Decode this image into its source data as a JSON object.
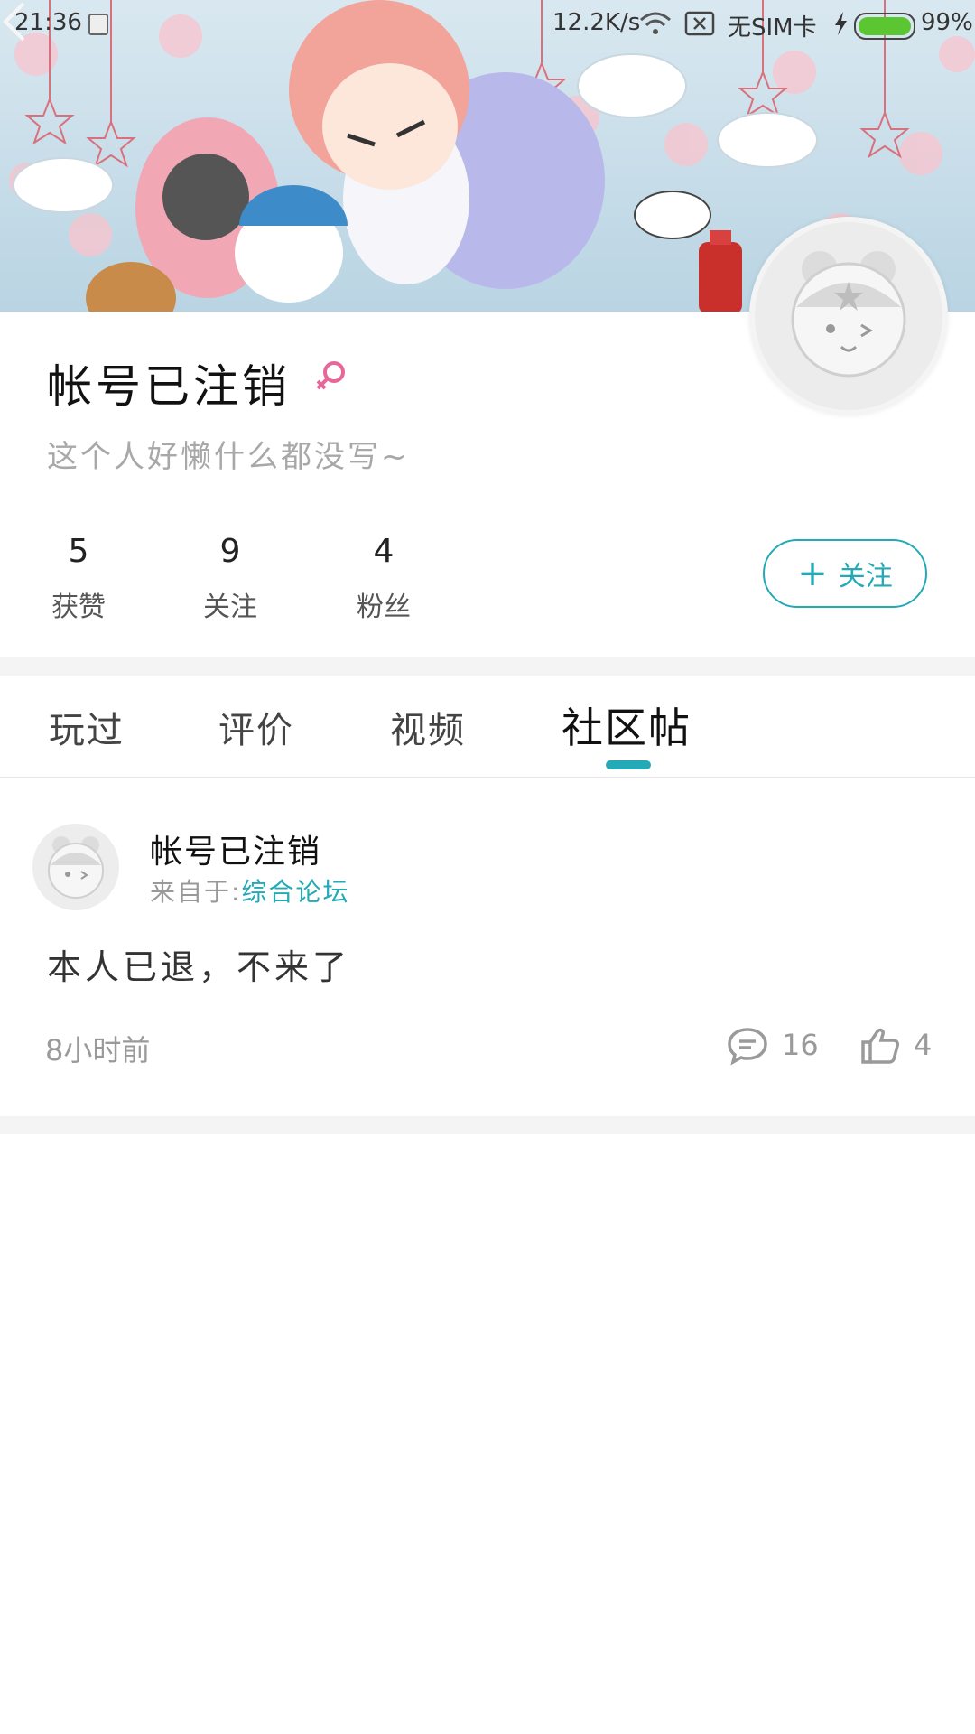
{
  "status_bar": {
    "time": "21:36",
    "net_speed": "12.2K/s",
    "sim_text": "无SIM卡",
    "battery_pct": "99%",
    "battery_level": 0.99
  },
  "profile": {
    "name": "帐号已注销",
    "bio": "这个人好懒什么都没写~",
    "stats": [
      {
        "value": "5",
        "label": "获赞"
      },
      {
        "value": "9",
        "label": "关注"
      },
      {
        "value": "4",
        "label": "粉丝"
      }
    ],
    "follow_label": "关注",
    "follow_plus": "+"
  },
  "tabs": [
    {
      "label": "玩过",
      "active": false
    },
    {
      "label": "评价",
      "active": false
    },
    {
      "label": "视频",
      "active": false
    },
    {
      "label": "社区帖",
      "active": true
    }
  ],
  "post": {
    "user": "帐号已注销",
    "from_prefix": "来自于:",
    "forum": "综合论坛",
    "body": "本人已退，不来了",
    "time": "8小时前",
    "comment_count": "16",
    "like_count": "4"
  },
  "colors": {
    "accent": "#23aab6",
    "gender_female": "#e8679a",
    "battery": "#5bc532"
  }
}
